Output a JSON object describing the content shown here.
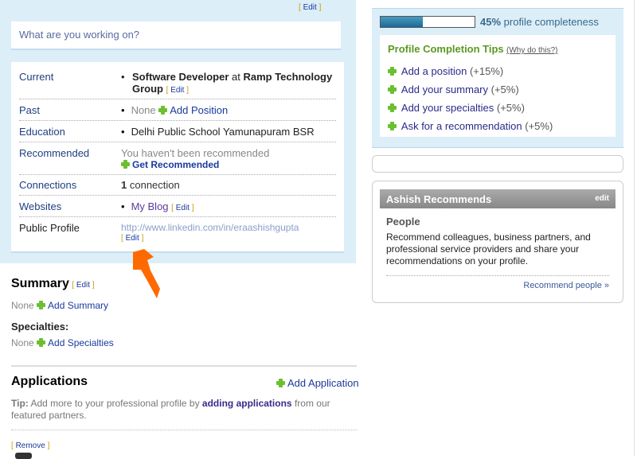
{
  "top_edit": "Edit",
  "status_placeholder": "What are you working on?",
  "profile_rows": {
    "current_label": "Current",
    "current_title": "Software Developer",
    "current_at": "at",
    "current_company": "Ramp Technology Group",
    "edit": "Edit",
    "past_label": "Past",
    "past_none": "None",
    "past_add": "Add Position",
    "education_label": "Education",
    "education_value": "Delhi Public School Yamunapuram BSR",
    "recommended_label": "Recommended",
    "recommended_text": "You haven't been recommended",
    "recommended_link": "Get Recommended",
    "connections_label": "Connections",
    "connections_count": "1",
    "connections_text": "connection",
    "websites_label": "Websites",
    "websites_value": "My Blog",
    "public_label": "Public Profile",
    "public_url": "http://www.linkedin.com/in/eraashishgupta"
  },
  "summary": {
    "title": "Summary",
    "edit": "Edit",
    "none": "None",
    "add": "Add Summary",
    "specialties_title": "Specialties:",
    "add_specialties": "Add Specialties"
  },
  "applications": {
    "title": "Applications",
    "add": "Add Application",
    "tip_label": "Tip:",
    "tip_text1": "Add more to your professional profile by",
    "tip_link": "adding applications",
    "tip_text2": "from our featured partners.",
    "remove": "Remove"
  },
  "completeness": {
    "percent": 45,
    "percent_text": "45%",
    "label": "profile completeness",
    "tips_title": "Profile Completion Tips",
    "why": "(Why do this?)",
    "tips": [
      {
        "text": "Add a position",
        "pct": "(+15%)"
      },
      {
        "text": "Add your summary",
        "pct": "(+5%)"
      },
      {
        "text": "Add your specialties",
        "pct": "(+5%)"
      },
      {
        "text": "Ask for a recommendation",
        "pct": "(+5%)"
      }
    ]
  },
  "recommends": {
    "title": "Ashish Recommends",
    "edit": "edit",
    "subtitle": "People",
    "text": "Recommend colleagues, business partners, and professional service providers and share your recommendations on your profile.",
    "link": "Recommend people »"
  },
  "colors": {
    "panel": "#dceef8",
    "accent": "#ff6a00"
  }
}
